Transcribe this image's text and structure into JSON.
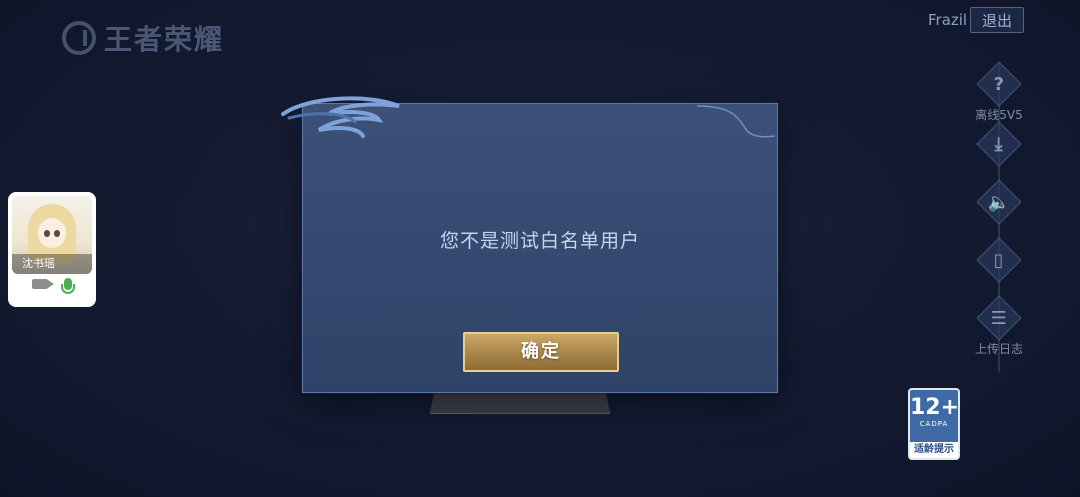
{
  "header": {
    "logo_text": "王者荣耀",
    "username": "Frazil",
    "logout_label": "退出"
  },
  "side_tools": [
    {
      "icon": "question-icon",
      "glyph": "?",
      "label": "离线5V5"
    },
    {
      "icon": "download-icon",
      "glyph": "⤓",
      "label": ""
    },
    {
      "icon": "speaker-icon",
      "glyph": "🔈",
      "label": ""
    },
    {
      "icon": "phone-icon",
      "glyph": "▯",
      "label": ""
    },
    {
      "icon": "log-icon",
      "glyph": "☰",
      "label": "上传日志"
    }
  ],
  "age_rating": {
    "age": "12+",
    "org": "CADPA",
    "tip": "适龄提示"
  },
  "video_call": {
    "caller_name": "沈书瑶"
  },
  "dialog": {
    "message": "您不是测试白名单用户",
    "confirm_label": "确定"
  },
  "colors": {
    "dialog_bg": "#3c5178",
    "button_gold": "#b08c4f",
    "button_border": "#e8cf8f",
    "mic_active": "#4caf50"
  }
}
